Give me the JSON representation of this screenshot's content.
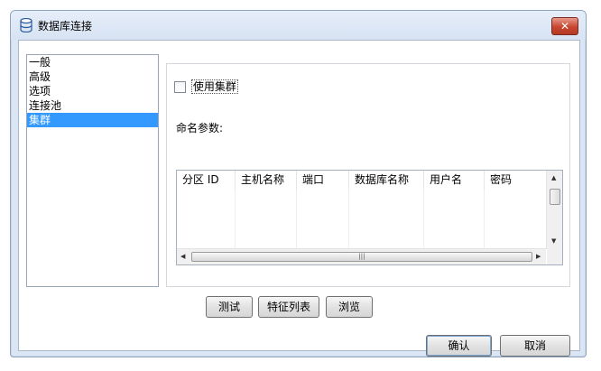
{
  "window": {
    "title": "数据库连接",
    "close_label": "✕"
  },
  "nav": {
    "items": [
      {
        "label": "一般"
      },
      {
        "label": "高级"
      },
      {
        "label": "选项"
      },
      {
        "label": "连接池"
      },
      {
        "label": "集群"
      }
    ],
    "selected_index": 4
  },
  "cluster": {
    "use_cluster_label": "使用集群",
    "use_cluster_checked": false,
    "params_label": "命名参数:",
    "table": {
      "columns": [
        "分区 ID",
        "主机名称",
        "端口",
        "数据库名称",
        "用户名",
        "密码"
      ],
      "rows": []
    },
    "scroll": {
      "hthumb_glyph": "|||"
    }
  },
  "action_buttons": {
    "test": "测试",
    "features": "特征列表",
    "browse": "浏览"
  },
  "dialog_buttons": {
    "ok": "确认",
    "cancel": "取消"
  }
}
